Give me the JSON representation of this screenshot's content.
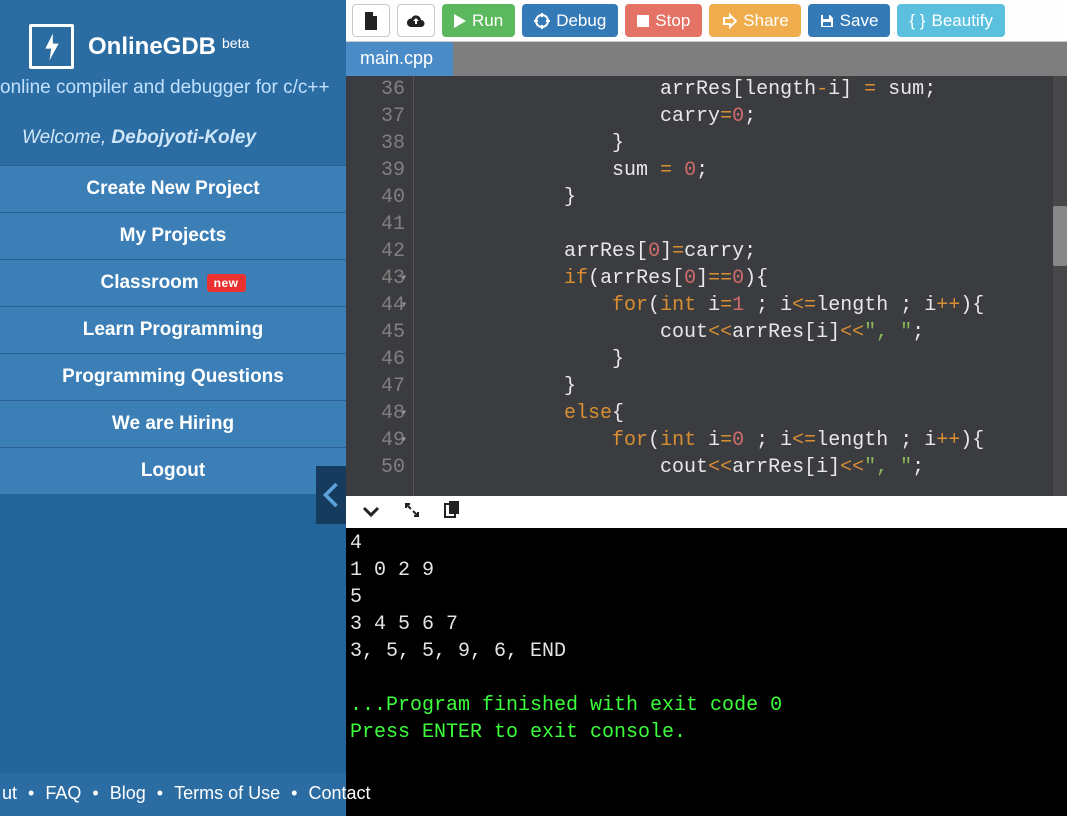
{
  "brand": {
    "title": "OnlineGDB",
    "badge": "beta",
    "tagline": "online compiler and debugger for c/c++"
  },
  "welcome": {
    "prefix": "Welcome, ",
    "user": "Debojyoti-Koley"
  },
  "nav": [
    {
      "label": "Create New Project"
    },
    {
      "label": "My Projects"
    },
    {
      "label": "Classroom",
      "badge": "new"
    },
    {
      "label": "Learn Programming"
    },
    {
      "label": "Programming Questions"
    },
    {
      "label": "We are Hiring"
    },
    {
      "label": "Logout"
    }
  ],
  "toolbar": {
    "run": "Run",
    "debug": "Debug",
    "stop": "Stop",
    "share": "Share",
    "save": "Save",
    "beautify": "Beautify"
  },
  "tab": {
    "name": "main.cpp"
  },
  "editor": {
    "first_line": 36,
    "lines": [
      {
        "n": 36,
        "indent": 20,
        "tokens": [
          [
            "id",
            "arrRes"
          ],
          [
            "pun",
            "["
          ],
          [
            "id",
            "length"
          ],
          [
            "op",
            "-"
          ],
          [
            "id",
            "i"
          ],
          [
            "pun",
            "]"
          ],
          [
            "pun",
            " "
          ],
          [
            "op",
            "="
          ],
          [
            "pun",
            " "
          ],
          [
            "id",
            "sum"
          ],
          [
            "pun",
            ";"
          ]
        ]
      },
      {
        "n": 37,
        "indent": 20,
        "tokens": [
          [
            "id",
            "carry"
          ],
          [
            "op",
            "="
          ],
          [
            "num",
            "0"
          ],
          [
            "pun",
            ";"
          ]
        ]
      },
      {
        "n": 38,
        "indent": 16,
        "tokens": [
          [
            "pun",
            "}"
          ]
        ]
      },
      {
        "n": 39,
        "indent": 16,
        "tokens": [
          [
            "id",
            "sum"
          ],
          [
            "pun",
            " "
          ],
          [
            "op",
            "="
          ],
          [
            "pun",
            " "
          ],
          [
            "num",
            "0"
          ],
          [
            "pun",
            ";"
          ]
        ]
      },
      {
        "n": 40,
        "indent": 12,
        "tokens": [
          [
            "pun",
            "}"
          ]
        ]
      },
      {
        "n": 41,
        "indent": 0,
        "tokens": []
      },
      {
        "n": 42,
        "indent": 12,
        "tokens": [
          [
            "id",
            "arrRes"
          ],
          [
            "pun",
            "["
          ],
          [
            "num",
            "0"
          ],
          [
            "pun",
            "]"
          ],
          [
            "op",
            "="
          ],
          [
            "id",
            "carry"
          ],
          [
            "pun",
            ";"
          ]
        ]
      },
      {
        "n": 43,
        "fold": true,
        "indent": 12,
        "tokens": [
          [
            "kw",
            "if"
          ],
          [
            "pun",
            "("
          ],
          [
            "id",
            "arrRes"
          ],
          [
            "pun",
            "["
          ],
          [
            "num",
            "0"
          ],
          [
            "pun",
            "]"
          ],
          [
            "op",
            "=="
          ],
          [
            "num",
            "0"
          ],
          [
            "pun",
            ")"
          ],
          [
            "pun",
            "{"
          ]
        ]
      },
      {
        "n": 44,
        "fold": true,
        "indent": 16,
        "tokens": [
          [
            "kw",
            "for"
          ],
          [
            "pun",
            "("
          ],
          [
            "kw",
            "int"
          ],
          [
            "pun",
            " "
          ],
          [
            "id",
            "i"
          ],
          [
            "op",
            "="
          ],
          [
            "num",
            "1"
          ],
          [
            "pun",
            " "
          ],
          [
            "pun",
            ";"
          ],
          [
            "pun",
            " "
          ],
          [
            "id",
            "i"
          ],
          [
            "op",
            "<="
          ],
          [
            "id",
            "length"
          ],
          [
            "pun",
            " "
          ],
          [
            "pun",
            ";"
          ],
          [
            "pun",
            " "
          ],
          [
            "id",
            "i"
          ],
          [
            "op",
            "++"
          ],
          [
            "pun",
            ")"
          ],
          [
            "pun",
            "{"
          ]
        ]
      },
      {
        "n": 45,
        "indent": 20,
        "tokens": [
          [
            "id",
            "cout"
          ],
          [
            "op",
            "<<"
          ],
          [
            "id",
            "arrRes"
          ],
          [
            "pun",
            "["
          ],
          [
            "id",
            "i"
          ],
          [
            "pun",
            "]"
          ],
          [
            "op",
            "<<"
          ],
          [
            "str",
            "\", \""
          ],
          [
            "pun",
            ";"
          ]
        ]
      },
      {
        "n": 46,
        "indent": 16,
        "tokens": [
          [
            "pun",
            "}"
          ]
        ]
      },
      {
        "n": 47,
        "indent": 12,
        "tokens": [
          [
            "pun",
            "}"
          ]
        ]
      },
      {
        "n": 48,
        "fold": true,
        "indent": 12,
        "tokens": [
          [
            "kw",
            "else"
          ],
          [
            "pun",
            "{"
          ]
        ]
      },
      {
        "n": 49,
        "fold": true,
        "indent": 16,
        "tokens": [
          [
            "kw",
            "for"
          ],
          [
            "pun",
            "("
          ],
          [
            "kw",
            "int"
          ],
          [
            "pun",
            " "
          ],
          [
            "id",
            "i"
          ],
          [
            "op",
            "="
          ],
          [
            "num",
            "0"
          ],
          [
            "pun",
            " "
          ],
          [
            "pun",
            ";"
          ],
          [
            "pun",
            " "
          ],
          [
            "id",
            "i"
          ],
          [
            "op",
            "<="
          ],
          [
            "id",
            "length"
          ],
          [
            "pun",
            " "
          ],
          [
            "pun",
            ";"
          ],
          [
            "pun",
            " "
          ],
          [
            "id",
            "i"
          ],
          [
            "op",
            "++"
          ],
          [
            "pun",
            ")"
          ],
          [
            "pun",
            "{"
          ]
        ]
      },
      {
        "n": 50,
        "indent": 20,
        "tokens": [
          [
            "id",
            "cout"
          ],
          [
            "op",
            "<<"
          ],
          [
            "id",
            "arrRes"
          ],
          [
            "pun",
            "["
          ],
          [
            "id",
            "i"
          ],
          [
            "pun",
            "]"
          ],
          [
            "op",
            "<<"
          ],
          [
            "str",
            "\", \""
          ],
          [
            "pun",
            ";"
          ]
        ]
      }
    ]
  },
  "output": {
    "plain": "4\n1 0 2 9\n5\n3 4 5 6 7\n3, 5, 5, 9, 6, END\n\n",
    "finished": "...Program finished with exit code 0",
    "prompt": "Press ENTER to exit console."
  },
  "footer": {
    "items": [
      "ut",
      "FAQ",
      "Blog",
      "Terms of Use",
      "Contact"
    ]
  }
}
